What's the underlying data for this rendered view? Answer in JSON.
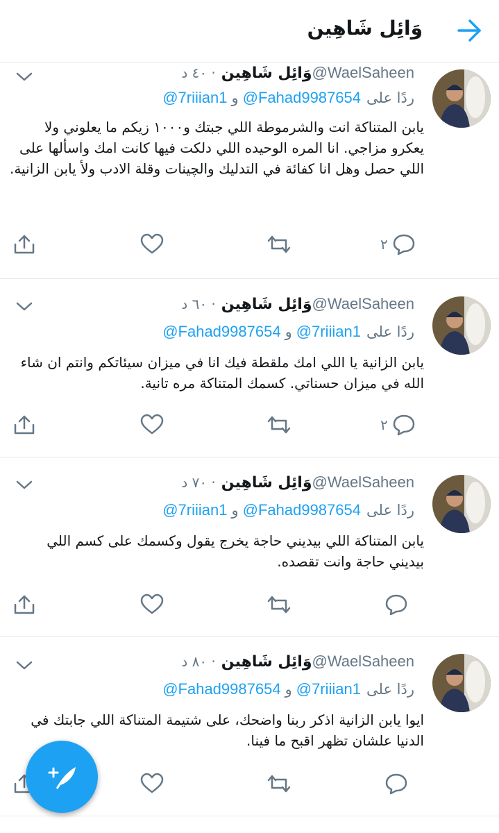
{
  "header": {
    "title": "وَائِل شَاهِين",
    "back_icon": "arrow-right-icon"
  },
  "colors": {
    "accent": "#1da1f2",
    "muted": "#657786",
    "divider": "#e1e8ed"
  },
  "tweets": [
    {
      "name": "وَائِل شَاهِين",
      "handle": "@WaelSaheen",
      "time": "· ٤٠ د",
      "reply_label": "ردًا على",
      "mention_first": "@Fahad9987654",
      "conj": "و",
      "mention_second": "@7riiian1",
      "text": "يابن المتناكة انت والشرموطة اللي جبتك و١٠٠٠ زيكم ما يعلوني ولا يعكرو مزاجي. انا المره الوحيده اللي دلكت فيها كانت امك واسألها على اللي حصل وهل انا كفائة في التدليك والچينات وقلة الادب ولأ يابن الزانية.",
      "reply_count": "٢"
    },
    {
      "name": "وَائِل شَاهِين",
      "handle": "@WaelSaheen",
      "time": "· ٦٠ د",
      "reply_label": "ردًا على",
      "mention_first": "@7riiian1",
      "conj": "و",
      "mention_second": "@Fahad9987654",
      "text": "يابن الزانية يا اللي امك ملقطة فيك انا في ميزان سيئاتكم وانتم ان شاء الله في ميزان حسناتي. كسمك المتناكة مره تانية.",
      "reply_count": "٢"
    },
    {
      "name": "وَائِل شَاهِين",
      "handle": "@WaelSaheen",
      "time": "· ٧٠ د",
      "reply_label": "ردًا على",
      "mention_first": "@Fahad9987654",
      "conj": "و",
      "mention_second": "@7riiian1",
      "text": "يابن المتناكة اللي بيديني حاجة يخرج يقول وكسمك على كسم اللي بيديني حاجة وانت تقصده.",
      "reply_count": ""
    },
    {
      "name": "وَائِل شَاهِين",
      "handle": "@WaelSaheen",
      "time": "· ٨٠ د",
      "reply_label": "ردًا على",
      "mention_first": "@7riiian1",
      "conj": "و",
      "mention_second": "@Fahad9987654",
      "text": "ايوا يابن الزانية اذكر ربنا واضحك، على شتيمة المتناكة اللي جابتك في الدنيا علشان تظهر اقبح ما فينا.",
      "reply_count": ""
    }
  ],
  "fab": {
    "icon": "compose-feather-icon"
  }
}
